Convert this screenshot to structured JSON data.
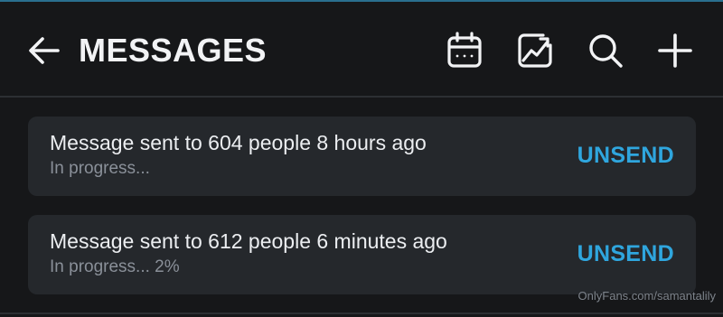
{
  "header": {
    "title": "MESSAGES",
    "icons": [
      "back-arrow-icon",
      "calendar-icon",
      "image-chart-icon",
      "search-icon",
      "plus-icon"
    ]
  },
  "messages": [
    {
      "text": "Message sent to 604 people 8 hours ago",
      "status": "In progress...",
      "action": "UNSEND"
    },
    {
      "text": "Message sent to 612 people 6 minutes ago",
      "status": "In progress... 2%",
      "action": "UNSEND"
    }
  ],
  "watermark": "OnlyFans.com/samantalily",
  "colors": {
    "background": "#161719",
    "card": "#25282c",
    "accent": "#2fa6de",
    "text": "#eceef1",
    "muted": "#8a9099"
  }
}
